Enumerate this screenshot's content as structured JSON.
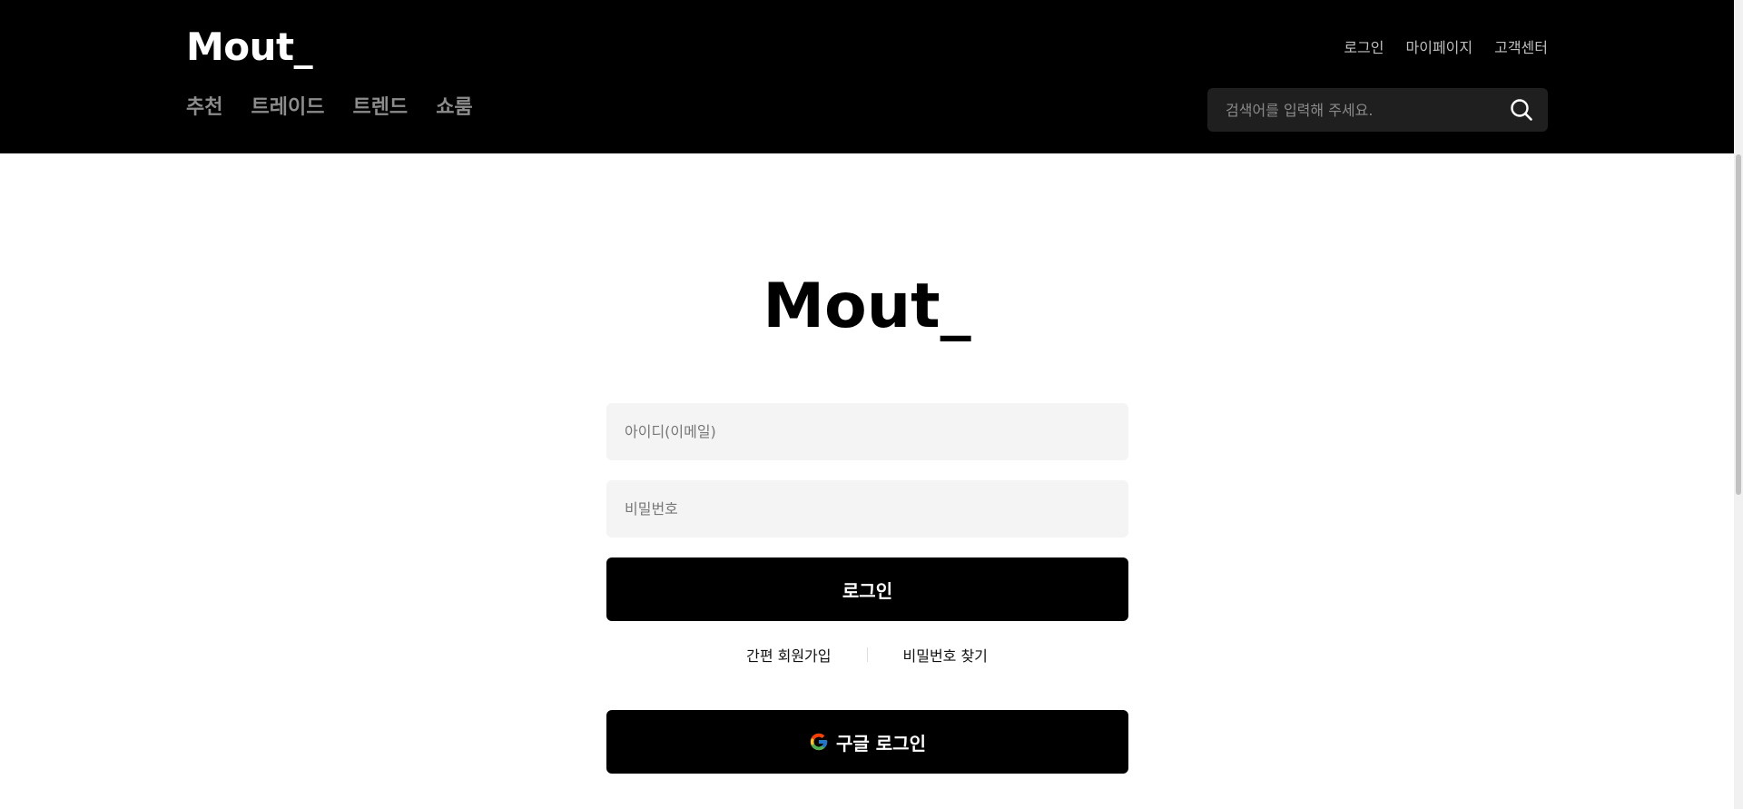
{
  "header": {
    "logo": "Mout_",
    "util_links": [
      "로그인",
      "마이페이지",
      "고객센터"
    ],
    "nav": [
      "추천",
      "트레이드",
      "트렌드",
      "쇼룸"
    ],
    "search": {
      "placeholder": "검색어를 입력해 주세요.",
      "icon": "search-icon"
    }
  },
  "login": {
    "title": "Mout_",
    "email_placeholder": "아이디(이메일)",
    "password_placeholder": "비밀번호",
    "login_button": "로그인",
    "signup_link": "간편 회원가입",
    "find_password_link": "비밀번호 찾기",
    "google_button": "구글 로그인",
    "google_icon": "google-icon"
  },
  "colors": {
    "header_bg": "#000000",
    "input_bg": "#f4f4f4",
    "button_bg": "#000000",
    "search_bg": "#1f1f1f"
  }
}
